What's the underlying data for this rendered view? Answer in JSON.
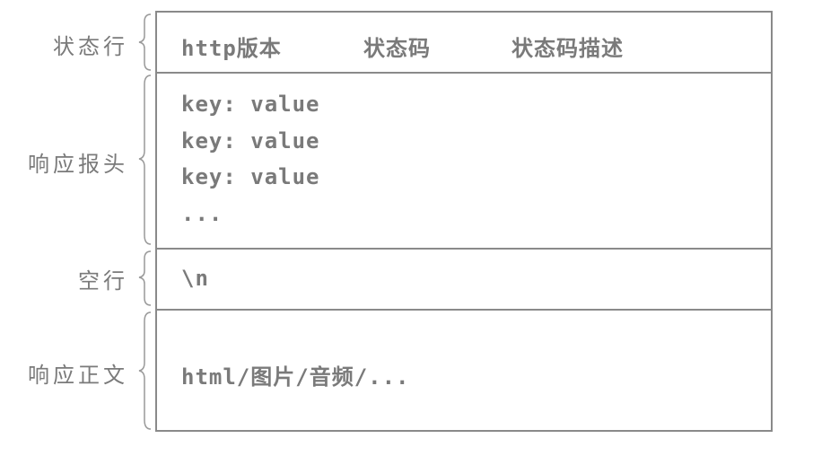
{
  "labels": {
    "status_line": "状态行",
    "headers": "响应报头",
    "blank_line": "空行",
    "body": "响应正文"
  },
  "status_line": {
    "version": "http版本",
    "code": "状态码",
    "description": "状态码描述"
  },
  "headers": [
    "key: value",
    "key: value",
    "key: value",
    "..."
  ],
  "blank_line": "\\n",
  "body": "html/图片/音频/..."
}
